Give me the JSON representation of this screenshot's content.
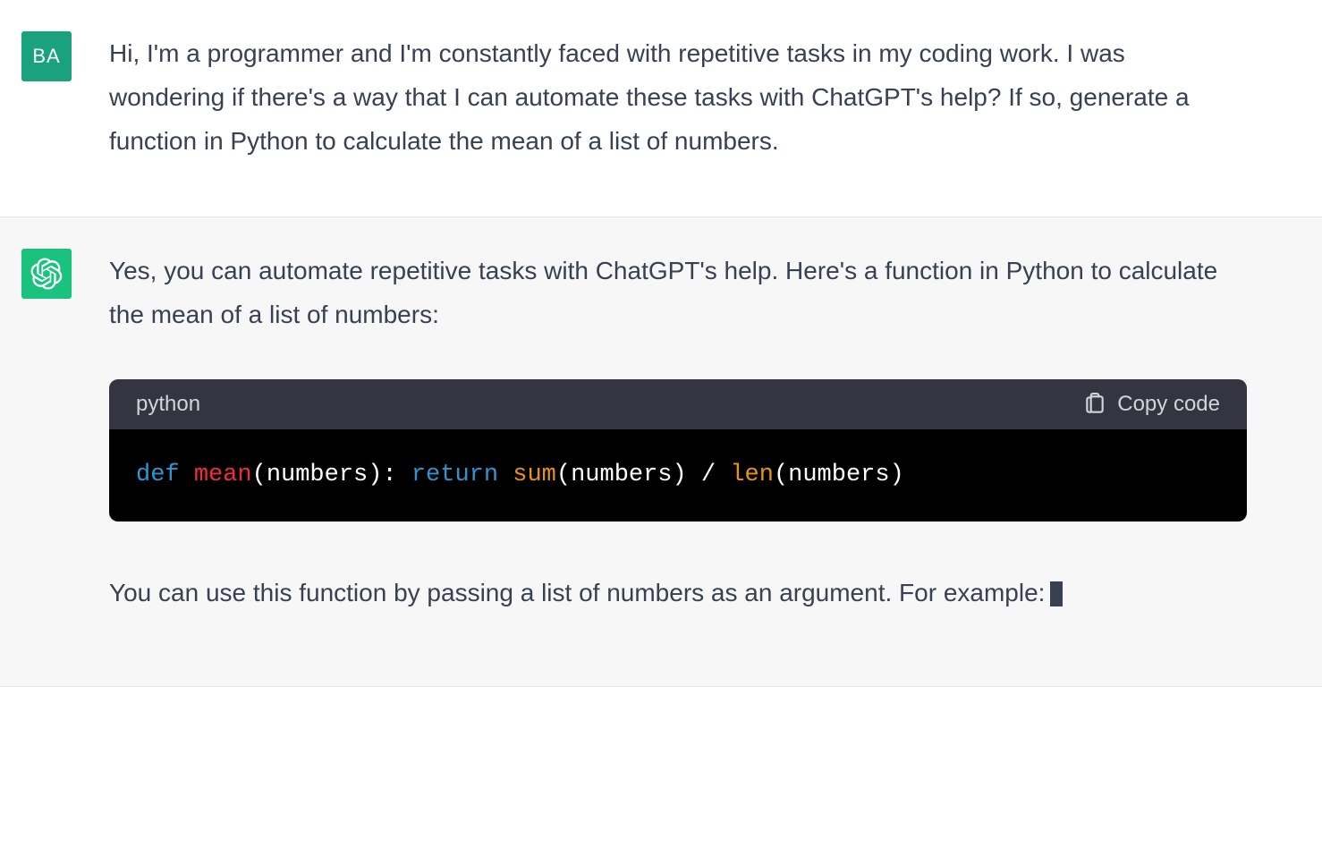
{
  "user": {
    "avatar_initials": "BA",
    "message": "Hi, I'm a programmer and I'm constantly faced with repetitive tasks in my coding work. I was wondering if there's a way that I can automate these tasks with ChatGPT's help? If so, generate a function in Python to calculate the mean of a list of numbers."
  },
  "assistant": {
    "intro_text": "Yes, you can automate repetitive tasks with ChatGPT's help. Here's a function in Python to calculate the mean of a list of numbers:",
    "code_block": {
      "language": "python",
      "copy_label": "Copy code",
      "tokens": {
        "def": "def",
        "func_name": "mean",
        "lparen1": "(",
        "params": "numbers",
        "rparen1": "):",
        "return": "return",
        "sum": "sum",
        "lparen2": "(",
        "arg1": "numbers",
        "rparen2": ")",
        "div": " / ",
        "len": "len",
        "lparen3": "(",
        "arg2": "numbers",
        "rparen3": ")"
      }
    },
    "followup_text": "You can use this function by passing a list of numbers as an argument. For example:"
  }
}
